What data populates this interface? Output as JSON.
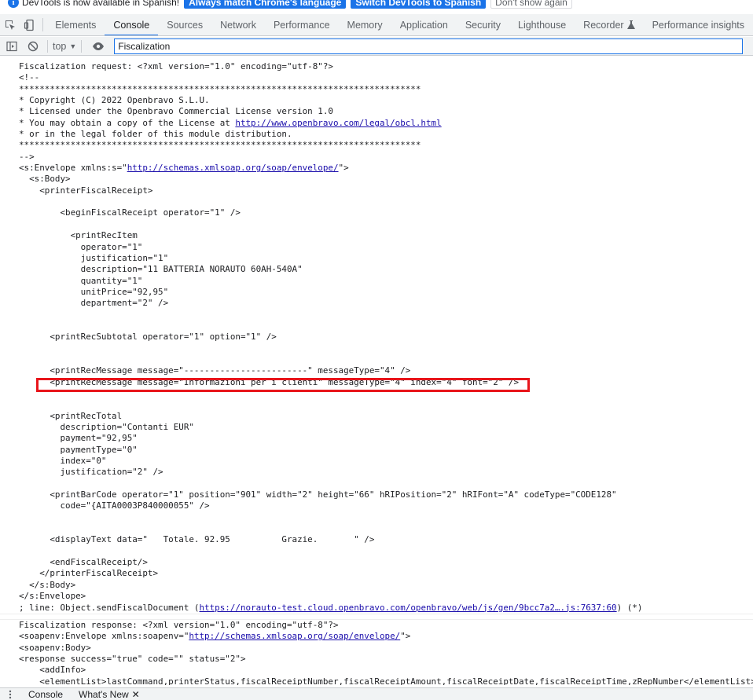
{
  "infobar": {
    "text": "DevTools is now available in Spanish!",
    "btn_match": "Always match Chrome's language",
    "btn_switch": "Switch DevTools to Spanish",
    "btn_dont": "Don't show again"
  },
  "tabs": [
    "Elements",
    "Console",
    "Sources",
    "Network",
    "Performance",
    "Memory",
    "Application",
    "Security",
    "Lighthouse",
    "Recorder",
    "Performance insights"
  ],
  "toolbar": {
    "context": "top",
    "filter_value": "Fiscalization"
  },
  "log1": {
    "line_pre": "Fiscalization request: <?xml version=\"1.0\" encoding=\"utf-8\"?>",
    "l2": "<!--",
    "l3": "******************************************************************************",
    "l4": "* Copyright (C) 2022 Openbravo S.L.U.",
    "l5": "* Licensed under the Openbravo Commercial License version 1.0",
    "l6_pre": "* You may obtain a copy of the License at ",
    "l6_link": "http://www.openbravo.com/legal/obcl.html",
    "l7": "* or in the legal folder of this module distribution.",
    "l8": "******************************************************************************",
    "l9": "-->",
    "l10_pre": "<s:Envelope xmlns:s=\"",
    "l10_link": "http://schemas.xmlsoap.org/soap/envelope/",
    "l10_post": "\">",
    "l11": "  <s:Body>",
    "l12": "    <printerFiscalReceipt>",
    "l13": "",
    "l14": "        <beginFiscalReceipt operator=\"1\" />",
    "l15": "",
    "l16": "          <printRecItem",
    "l17": "            operator=\"1\"",
    "l18": "            justification=\"1\"",
    "l19": "            description=\"11 BATTERIA NORAUTO 60AH-540A\"",
    "l20": "            quantity=\"1\"",
    "l21": "            unitPrice=\"92,95\"",
    "l22": "            department=\"2\" />",
    "l23": "",
    "l24": "",
    "l25": "      <printRecSubtotal operator=\"1\" option=\"1\" />",
    "l26": "",
    "l27": "",
    "l28": "      <printRecMessage message=\"------------------------\" messageType=\"4\" />",
    "l29": "      <printRecMessage message=\"Informazioni per i clienti\" messageType=\"4\" index=\"4\" font=\"2\" />",
    "l30": "",
    "l31": "",
    "l32": "      <printRecTotal",
    "l33": "        description=\"Contanti EUR\"",
    "l34": "        payment=\"92,95\"",
    "l35": "        paymentType=\"0\"",
    "l36": "        index=\"0\"",
    "l37": "        justification=\"2\" />",
    "l38": "",
    "l39": "      <printBarCode operator=\"1\" position=\"901\" width=\"2\" height=\"66\" hRIPosition=\"2\" hRIFont=\"A\" codeType=\"CODE128\"",
    "l40": "        code=\"{AITA0003P840000055\" />",
    "l41": "",
    "l42": "",
    "l43": "      <displayText data=\"   Totale. 92.95          Grazie.       \" />",
    "l44": "",
    "l45": "      <endFiscalReceipt/>",
    "l46": "    </printerFiscalReceipt>",
    "l47": "  </s:Body>",
    "l48": "</s:Envelope>",
    "l49_pre": "; line: Object.sendFiscalDocument (",
    "l49_link": "https://norauto-test.cloud.openbravo.com/openbravo/web/js/gen/9bcc7a2….js:7637:60",
    "l49_post": ") (*)"
  },
  "log2": {
    "l1": "Fiscalization response: <?xml version=\"1.0\" encoding=\"utf-8\"?>",
    "l2_pre": "<soapenv:Envelope xmlns:soapenv=\"",
    "l2_link": "http://schemas.xmlsoap.org/soap/envelope/",
    "l2_post": "\">",
    "l3": "<soapenv:Body>",
    "l4": "<response success=\"true\" code=\"\" status=\"2\">",
    "l5": "    <addInfo>",
    "l6": "    <elementList>lastCommand,printerStatus,fiscalReceiptNumber,fiscalReceiptAmount,fiscalReceiptDate,fiscalReceiptTime,zRepNumber</elementList>"
  },
  "drawer": {
    "tab1": "Console",
    "tab2": "What's New"
  },
  "colors": {
    "accent": "#1a73e8",
    "highlight": "#e8151b"
  }
}
